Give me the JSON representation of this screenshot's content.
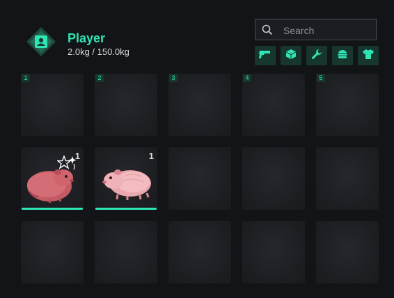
{
  "player": {
    "name": "Player",
    "weight": "2.0kg / 150.0kg",
    "avatar_icon": "player-badge-icon"
  },
  "search": {
    "placeholder": "Search",
    "value": ""
  },
  "filters": [
    {
      "name": "weapons",
      "icon": "pistol-icon"
    },
    {
      "name": "items",
      "icon": "box-icon"
    },
    {
      "name": "tools",
      "icon": "wrench-icon"
    },
    {
      "name": "food",
      "icon": "burger-icon"
    },
    {
      "name": "clothing",
      "icon": "shirt-icon"
    }
  ],
  "colors": {
    "accent": "#2ee6b4",
    "background": "#131418",
    "slot": "#1d1e22",
    "filter_bg": "#17362e"
  },
  "hotbar_numbers": [
    "1",
    "2",
    "3",
    "4",
    "5"
  ],
  "slots": [
    {
      "row": 1,
      "col": 1,
      "number": "1",
      "item": null
    },
    {
      "row": 1,
      "col": 2,
      "number": "2",
      "item": null
    },
    {
      "row": 1,
      "col": 3,
      "number": "3",
      "item": null
    },
    {
      "row": 1,
      "col": 4,
      "number": "4",
      "item": null
    },
    {
      "row": 1,
      "col": 5,
      "number": "5",
      "item": null
    },
    {
      "row": 2,
      "col": 1,
      "item": {
        "icon": "guinea-pig-red-icon",
        "count": "1",
        "durability": 1.0,
        "status_icon": "star-sparkle-icon"
      }
    },
    {
      "row": 2,
      "col": 2,
      "item": {
        "icon": "guinea-pig-pink-icon",
        "count": "1",
        "durability": 1.0
      }
    },
    {
      "row": 2,
      "col": 3,
      "item": null
    },
    {
      "row": 2,
      "col": 4,
      "item": null
    },
    {
      "row": 2,
      "col": 5,
      "item": null
    },
    {
      "row": 3,
      "col": 1,
      "item": null
    },
    {
      "row": 3,
      "col": 2,
      "item": null
    },
    {
      "row": 3,
      "col": 3,
      "item": null
    },
    {
      "row": 3,
      "col": 4,
      "item": null
    },
    {
      "row": 3,
      "col": 5,
      "item": null
    }
  ]
}
